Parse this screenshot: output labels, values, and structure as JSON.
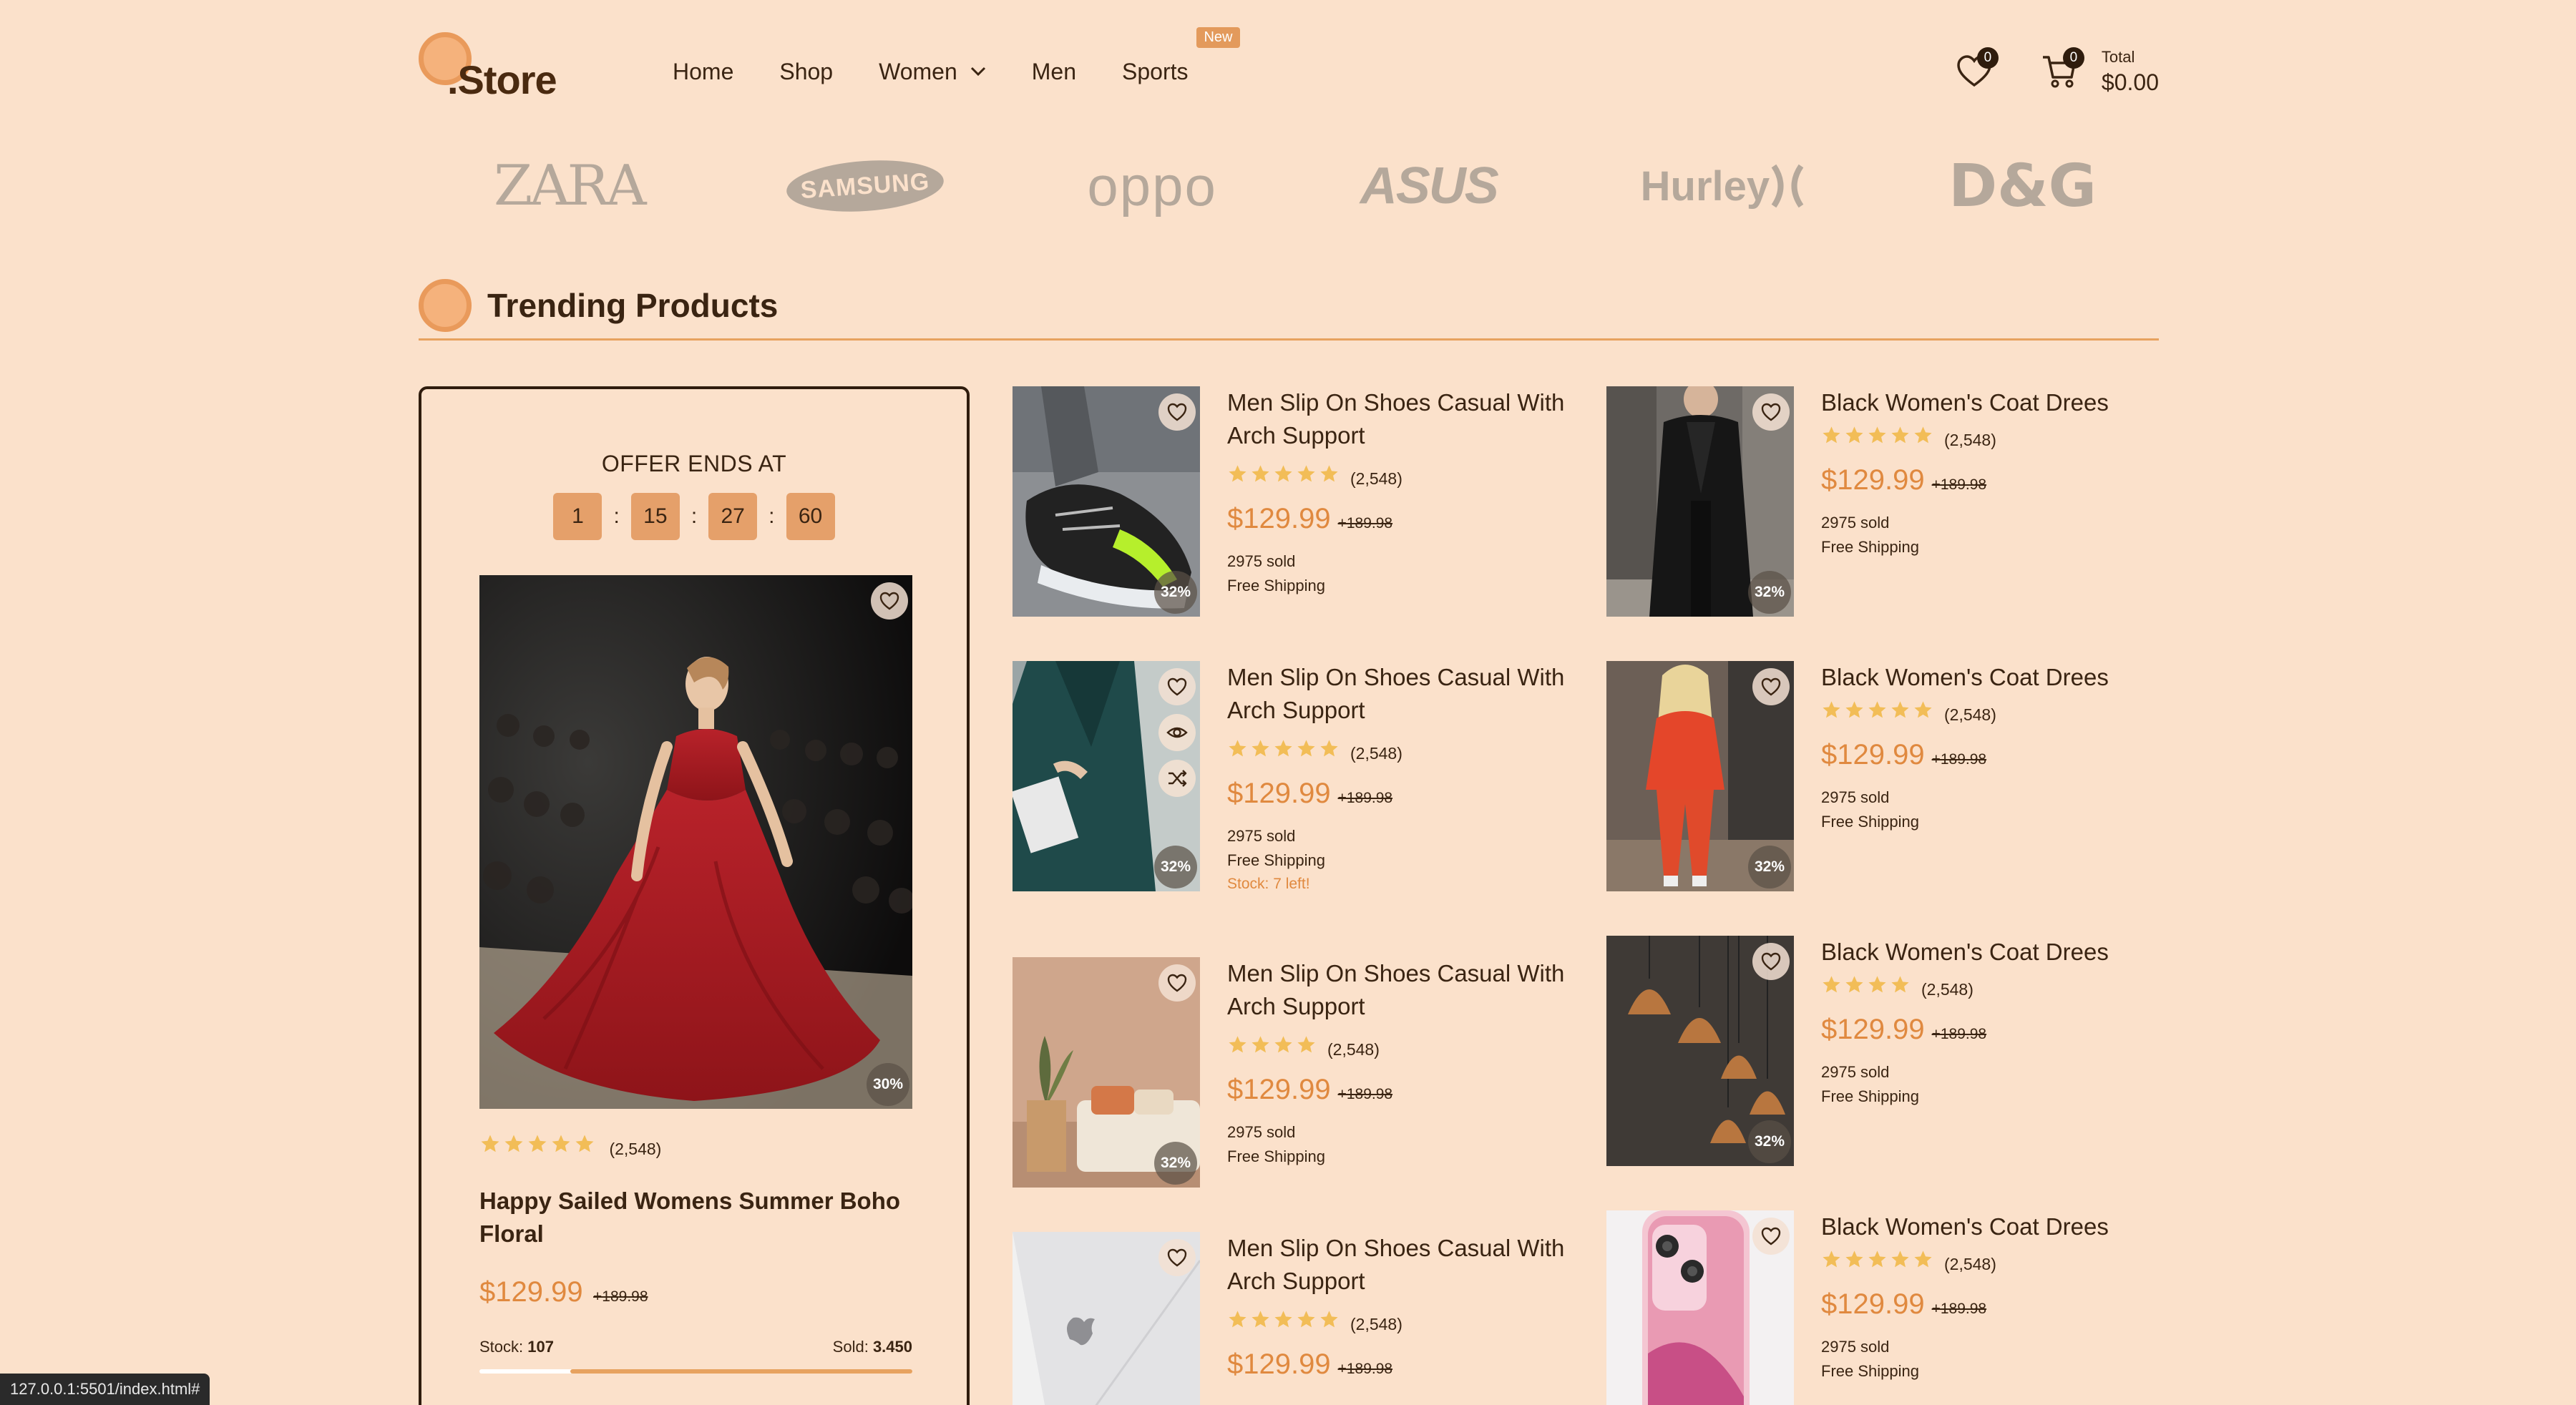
{
  "logo": {
    "text": ".Store"
  },
  "nav": {
    "home": "Home",
    "shop": "Shop",
    "women": "Women",
    "men": "Men",
    "sports": "Sports",
    "sports_badge": "New"
  },
  "header": {
    "wishlist_count": "0",
    "cart_count": "0",
    "total_label": "Total",
    "total_value": "$0.00"
  },
  "brands": {
    "zara": "ZARA",
    "samsung": "SAMSUNG",
    "oppo": "oppo",
    "asus": "ASUS",
    "hurley": "Hurley",
    "dg": "D&G"
  },
  "section": {
    "title": "Trending Products"
  },
  "offer": {
    "heading": "OFFER ENDS AT",
    "countdown": [
      "1",
      "15",
      "27",
      "60"
    ],
    "discount": "30%",
    "rating_stars": 5,
    "rating_count": "(2,548)",
    "name": "Happy Sailed Womens Summer Boho Floral",
    "price": "$129.99",
    "old_price": "+189.98",
    "stock_label": "Stock:",
    "stock_value": "107",
    "sold_label": "Sold:",
    "sold_value": "3.450",
    "progress_fraction": 0.79
  },
  "products_left": [
    {
      "name": "Men Slip On Shoes Casual With Arch Support",
      "stars": 5,
      "rating": "(2,548)",
      "price": "$129.99",
      "old": "+189.98",
      "sold": "2975 sold",
      "ship": "Free Shipping",
      "discount": "32%",
      "stock": ""
    },
    {
      "name": "Men Slip On Shoes Casual With Arch Support",
      "stars": 5,
      "rating": "(2,548)",
      "price": "$129.99",
      "old": "+189.98",
      "sold": "2975 sold",
      "ship": "Free Shipping",
      "discount": "32%",
      "stock": "Stock: 7 left!"
    },
    {
      "name": "Men Slip On Shoes Casual With Arch Support",
      "stars": 4,
      "rating": "(2,548)",
      "price": "$129.99",
      "old": "+189.98",
      "sold": "2975 sold",
      "ship": "Free Shipping",
      "discount": "32%",
      "stock": ""
    },
    {
      "name": "Men Slip On Shoes Casual With Arch Support",
      "stars": 5,
      "rating": "(2,548)",
      "price": "$129.99",
      "old": "+189.98",
      "sold": "",
      "ship": "",
      "discount": "",
      "stock": ""
    }
  ],
  "products_right": [
    {
      "name": "Black Women's Coat Drees",
      "stars": 5,
      "rating": "(2,548)",
      "price": "$129.99",
      "old": "+189.98",
      "sold": "2975 sold",
      "ship": "Free Shipping",
      "discount": "32%"
    },
    {
      "name": "Black Women's Coat Drees",
      "stars": 5,
      "rating": "(2,548)",
      "price": "$129.99",
      "old": "+189.98",
      "sold": "2975 sold",
      "ship": "Free Shipping",
      "discount": "32%"
    },
    {
      "name": "Black Women's Coat Drees",
      "stars": 4,
      "rating": "(2,548)",
      "price": "$129.99",
      "old": "+189.98",
      "sold": "2975 sold",
      "ship": "Free Shipping",
      "discount": "32%"
    },
    {
      "name": "Black Women's Coat Drees",
      "stars": 5,
      "rating": "(2,548)",
      "price": "$129.99",
      "old": "+189.98",
      "sold": "2975 sold",
      "ship": "Free Shipping",
      "discount": ""
    }
  ],
  "status_bar": {
    "url": "127.0.0.1:5501/index.html#"
  },
  "colors": {
    "background": "#fbe1cb",
    "accent": "#e0893f",
    "star": "#f2bd57",
    "dark": "#2f1c0d"
  }
}
